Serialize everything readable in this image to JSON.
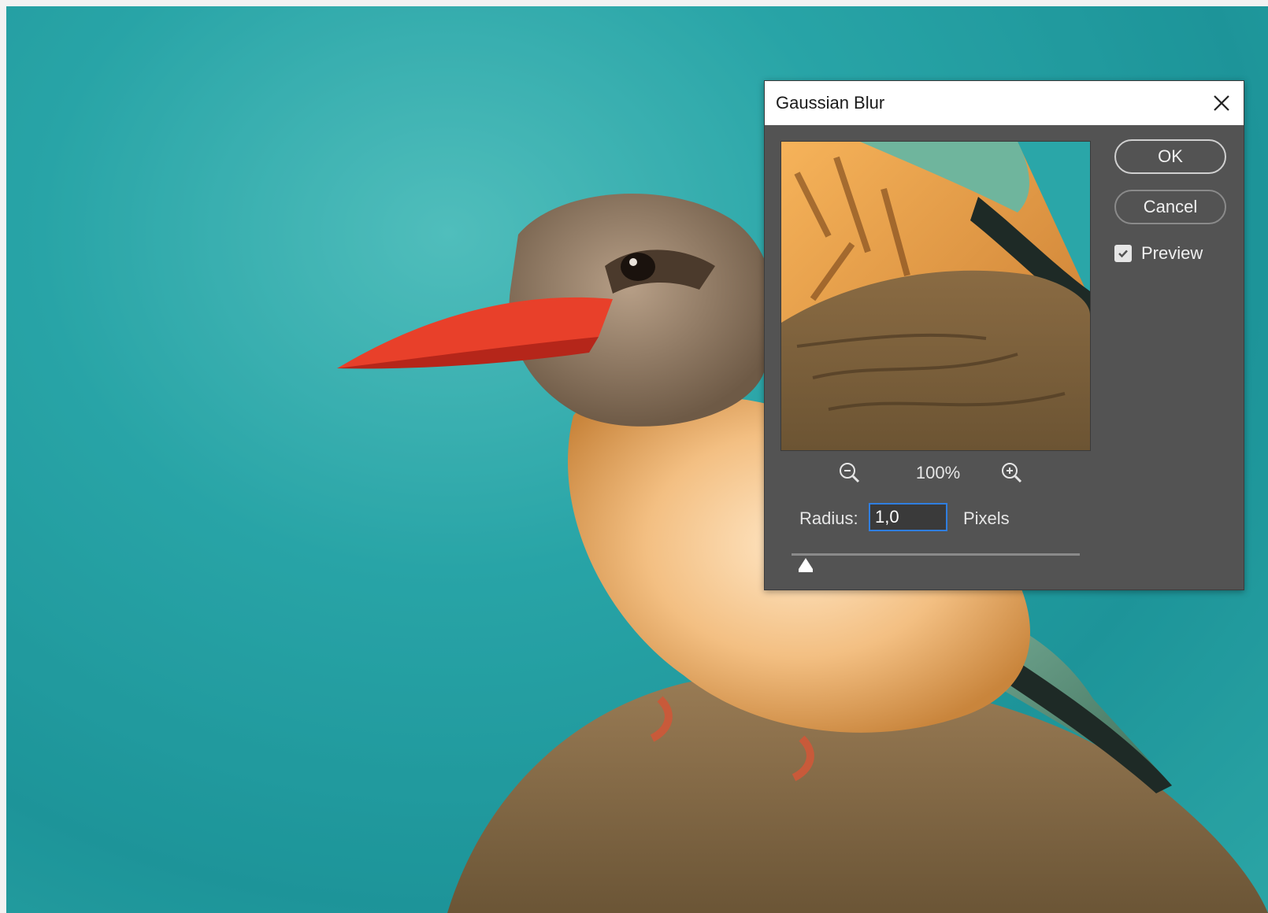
{
  "dialog": {
    "title": "Gaussian Blur",
    "close_icon": "close-icon",
    "ok_label": "OK",
    "cancel_label": "Cancel",
    "preview_label": "Preview",
    "preview_checked": true,
    "zoom_level": "100%",
    "zoom_out_icon": "zoom-out-icon",
    "zoom_in_icon": "zoom-in-icon",
    "radius_label": "Radius:",
    "radius_value": "1,0",
    "radius_units": "Pixels",
    "slider_fraction": 0.05
  },
  "colors": {
    "dialog_bg": "#535353",
    "titlebar_bg": "#ffffff",
    "accent_focus": "#2f7ee0",
    "background_teal": "#2aa6a8",
    "beak_red": "#e8402a"
  }
}
